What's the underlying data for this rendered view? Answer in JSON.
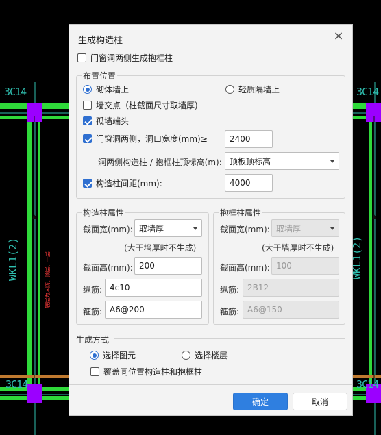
{
  "cad": {
    "labels": [
      "3C14",
      "3C14",
      "3C14",
      "3C14"
    ],
    "beam_label": "WKL1(2)",
    "beam_label_right": "WKL1(2)",
    "red_note": "底层为人防、顶层、一层",
    "colors": {
      "wall": "#2fd93a",
      "column": "#9b00ff",
      "axis": "#2fbfb0",
      "beam": "#c07a30"
    }
  },
  "dialog": {
    "title": "生成构造柱",
    "close_label": "×",
    "door_window_frame": {
      "label": "门窗洞两侧生成抱框柱",
      "checked": false
    },
    "placement": {
      "title": "布置位置",
      "masonry_label": "砌体墙上",
      "light_partition_label": "轻质隔墙上",
      "selected": "masonry",
      "wall_intersection": {
        "label": "墙交点（柱截面尺寸取墙厚)",
        "checked": false
      },
      "isolated_wall_end": {
        "label": "孤墙端头",
        "checked": true
      },
      "door_window_sides": {
        "label": "门窗洞两侧，洞口宽度(mm)≥",
        "checked": true,
        "value": "2400"
      },
      "top_elevation": {
        "label": "洞两侧构造柱 / 抱框柱顶标高(m):",
        "value": "顶板顶标高"
      },
      "column_spacing": {
        "label": "构造柱间距(mm):",
        "checked": true,
        "value": "4000"
      }
    },
    "construct_column": {
      "title": "构造柱属性",
      "width_label": "截面宽(mm):",
      "width_value": "取墙厚",
      "note": "(大于墙厚时不生成)",
      "height_label": "截面高(mm):",
      "height_value": "200",
      "long_bar_label": "纵筋:",
      "long_bar_value": "4c10",
      "stirrup_label": "箍筋:",
      "stirrup_value": "A6@200"
    },
    "frame_column": {
      "title": "抱框柱属性",
      "width_label": "截面宽(mm):",
      "width_value": "取墙厚",
      "note": "(大于墙厚时不生成)",
      "height_label": "截面高(mm):",
      "height_value": "100",
      "long_bar_label": "纵筋:",
      "long_bar_value": "2B12",
      "stirrup_label": "箍筋:",
      "stirrup_value": "A6@150"
    },
    "generation": {
      "title": "生成方式",
      "select_element_label": "选择图元",
      "select_floor_label": "选择楼层",
      "selected": "element",
      "override": {
        "label": "覆盖同位置构造柱和抱框柱",
        "checked": false
      }
    },
    "ok_label": "确定",
    "cancel_label": "取消",
    "colors": {
      "primary": "#2f7fe0",
      "check": "#2f6fd0"
    }
  }
}
